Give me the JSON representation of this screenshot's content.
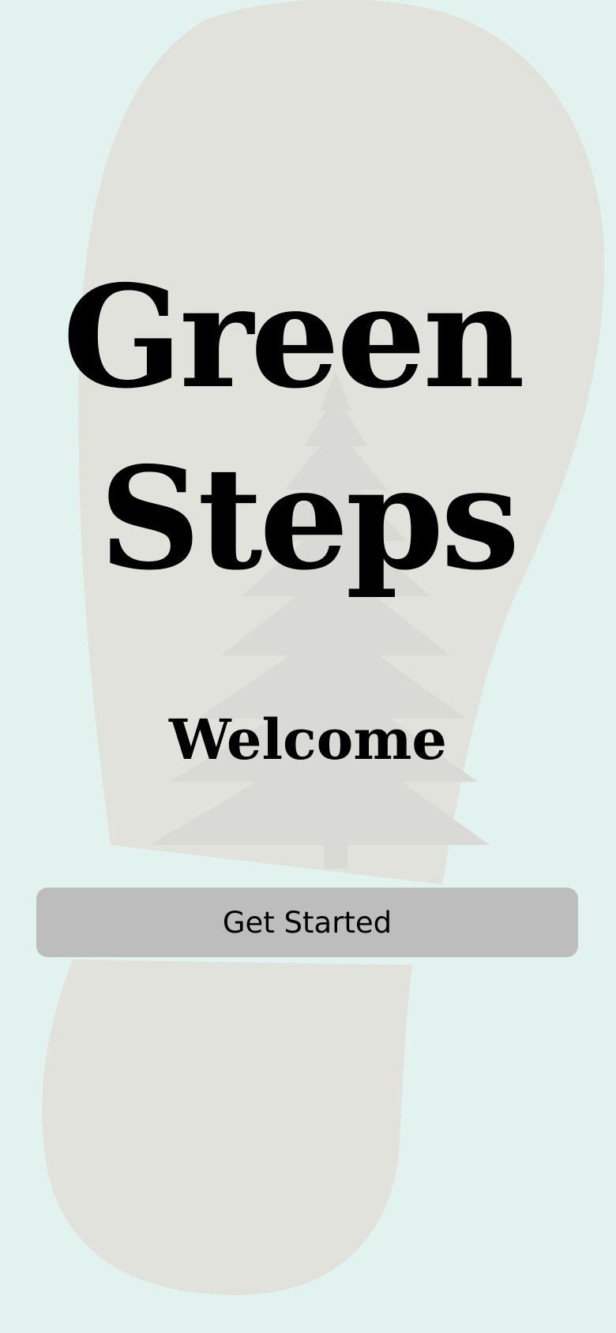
{
  "app": {
    "title_line1": "Green",
    "title_line2": "Steps",
    "welcome": "Welcome"
  },
  "actions": {
    "get_started_label": "Get Started"
  },
  "background": {
    "icon": "footprint-icon",
    "overlay_icon": "pine-tree-icon"
  },
  "colors": {
    "page_background": "#e2f3ef",
    "footprint": "#e2e2dc",
    "tree": "#d8d8d6",
    "button": "#bdbdbd",
    "text": "#000000"
  }
}
